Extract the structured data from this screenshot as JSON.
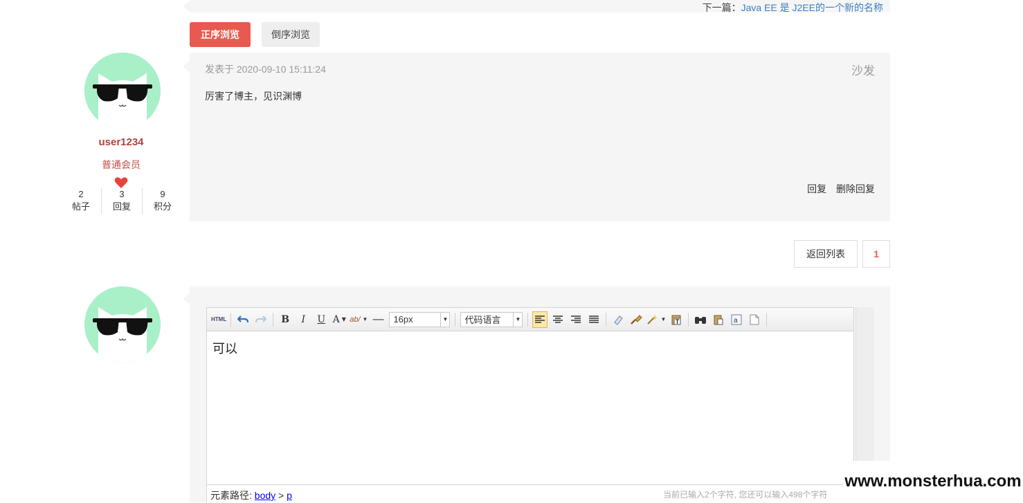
{
  "nav": {
    "next_prefix": "下一篇：",
    "next_title": "Java EE 是 J2EE的一个新的名称"
  },
  "sort": {
    "asc_label": "正序浏览",
    "desc_label": "倒序浏览"
  },
  "reply": {
    "user": {
      "name": "user1234",
      "role": "普通会员",
      "stats": [
        {
          "value": "2",
          "label": "帖子"
        },
        {
          "value": "3",
          "label": "回复"
        },
        {
          "value": "9",
          "label": "积分"
        }
      ]
    },
    "time": "发表于 2020-09-10 15:11:24",
    "floor": "沙发",
    "content": "厉害了博主，见识渊博",
    "actions": [
      "回复",
      "删除回复"
    ]
  },
  "pagination": {
    "back_label": "返回列表",
    "current_page": "1"
  },
  "editor": {
    "font_size": "16px",
    "code_lang": "代码语言",
    "content": "可以",
    "path_label": "元素路径: ",
    "path_items": [
      "body",
      "p"
    ],
    "path_sep": " > ",
    "word_count": "当前已输入2个字符, 您还可以输入498个字符"
  },
  "watermark": "www.monsterhua.com",
  "colors": {
    "accent": "#e85a4f",
    "avatar_bg": "#a9f0c9",
    "link": "#3b7fc0"
  }
}
